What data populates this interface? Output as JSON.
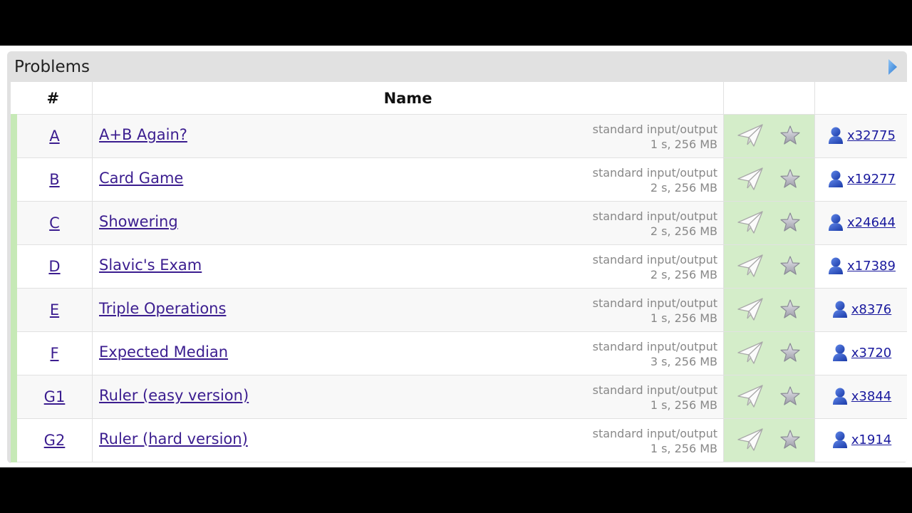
{
  "panel": {
    "title": "Problems"
  },
  "table": {
    "headers": {
      "id": "#",
      "name": "Name"
    },
    "rows": [
      {
        "id": "A",
        "name": "A+B Again?",
        "io": "standard input/output",
        "limits": "1 s, 256 MB",
        "solved": "x32775"
      },
      {
        "id": "B",
        "name": "Card Game",
        "io": "standard input/output",
        "limits": "2 s, 256 MB",
        "solved": "x19277"
      },
      {
        "id": "C",
        "name": "Showering",
        "io": "standard input/output",
        "limits": "2 s, 256 MB",
        "solved": "x24644"
      },
      {
        "id": "D",
        "name": "Slavic's Exam",
        "io": "standard input/output",
        "limits": "2 s, 256 MB",
        "solved": "x17389"
      },
      {
        "id": "E",
        "name": "Triple Operations",
        "io": "standard input/output",
        "limits": "1 s, 256 MB",
        "solved": "x8376"
      },
      {
        "id": "F",
        "name": "Expected Median",
        "io": "standard input/output",
        "limits": "3 s, 256 MB",
        "solved": "x3720"
      },
      {
        "id": "G1",
        "name": "Ruler (easy version)",
        "io": "standard input/output",
        "limits": "1 s, 256 MB",
        "solved": "x3844"
      },
      {
        "id": "G2",
        "name": "Ruler (hard version)",
        "io": "standard input/output",
        "limits": "1 s, 256 MB",
        "solved": "x1914"
      }
    ]
  },
  "icons": {
    "toggle": "triangle-right-icon",
    "submit": "paper-plane-icon",
    "favorite": "star-icon",
    "solvers": "user-icon"
  },
  "colors": {
    "accepted_bar": "#c6e9b6",
    "action_cell": "#d4edc9",
    "link": "#3b1d8f",
    "solved_link": "#1a1a9e",
    "toggle_arrow": "#3d8de0"
  }
}
